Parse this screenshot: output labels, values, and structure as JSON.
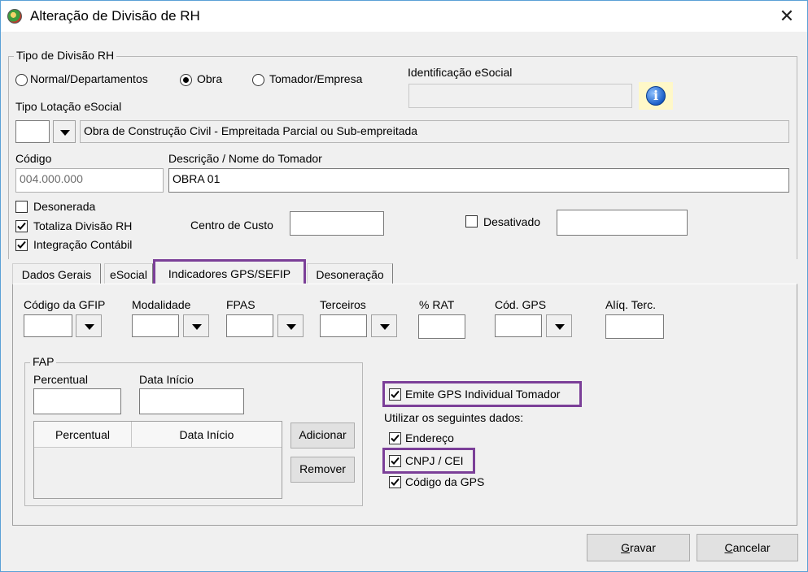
{
  "window": {
    "title": "Alteração de Divisão de RH"
  },
  "tipo_divisao": {
    "legend": "Tipo de Divisão RH",
    "options": [
      {
        "label": "Normal/Departamentos",
        "selected": false
      },
      {
        "label": "Obra",
        "selected": true
      },
      {
        "label": "Tomador/Empresa",
        "selected": false
      }
    ],
    "identificacao_label": "Identificação eSocial",
    "identificacao_value": "",
    "tipo_lotacao_label": "Tipo Lotação eSocial",
    "tipo_lotacao_code": "",
    "tipo_lotacao_desc": "Obra de Construção Civil - Empreitada Parcial ou Sub-empreitada",
    "codigo_label": "Código",
    "codigo_value": "004.000.000",
    "descricao_label": "Descrição / Nome do Tomador",
    "descricao_value": "OBRA 01",
    "desonerada_label": "Desonerada",
    "desonerada_checked": false,
    "totaliza_label": "Totaliza Divisão RH",
    "totaliza_checked": true,
    "integracao_label": "Integração Contábil",
    "integracao_checked": true,
    "centro_custo_label": "Centro de Custo",
    "centro_custo_value": "",
    "desativado_label": "Desativado",
    "desativado_checked": false,
    "desativado_value": ""
  },
  "tabs": [
    {
      "label": "Dados Gerais",
      "active": false
    },
    {
      "label": "eSocial",
      "active": false
    },
    {
      "label": "Indicadores GPS/SEFIP",
      "active": true
    },
    {
      "label": "Desoneração",
      "active": false
    }
  ],
  "gps": {
    "codigo_gfip_label": "Código da GFIP",
    "modalidade_label": "Modalidade",
    "fpas_label": "FPAS",
    "terceiros_label": "Terceiros",
    "rat_label": "% RAT",
    "cod_gps_label": "Cód. GPS",
    "aliq_terc_label": "Alíq. Terc.",
    "fap_legend": "FAP",
    "fap_percentual_label": "Percentual",
    "fap_data_inicio_label": "Data Início",
    "fap_columns": [
      "Percentual",
      "Data Início"
    ],
    "adicionar_label": "Adicionar",
    "remover_label": "Remover",
    "emite_label": "Emite GPS Individual Tomador",
    "emite_checked": true,
    "utilizar_label": "Utilizar os seguintes dados:",
    "endereco_label": "Endereço",
    "endereco_checked": true,
    "cnpj_label": "CNPJ / CEI",
    "cnpj_checked": true,
    "codigo_gps_label": "Código da GPS",
    "codigo_gps_checked": true
  },
  "footer": {
    "gravar_label": "Gravar",
    "gravar_mnemonic": "G",
    "gravar_rest": "ravar",
    "cancelar_label": "Cancelar",
    "cancelar_mnemonic": "C",
    "cancelar_rest": "ancelar"
  },
  "colors": {
    "highlight": "#7b3f98",
    "window_border": "#5aa0d6",
    "dialog_bg": "#f0f0f0"
  },
  "icons": [
    "app-icon",
    "close-icon",
    "info-icon",
    "chevron-down-icon",
    "check-icon"
  ]
}
